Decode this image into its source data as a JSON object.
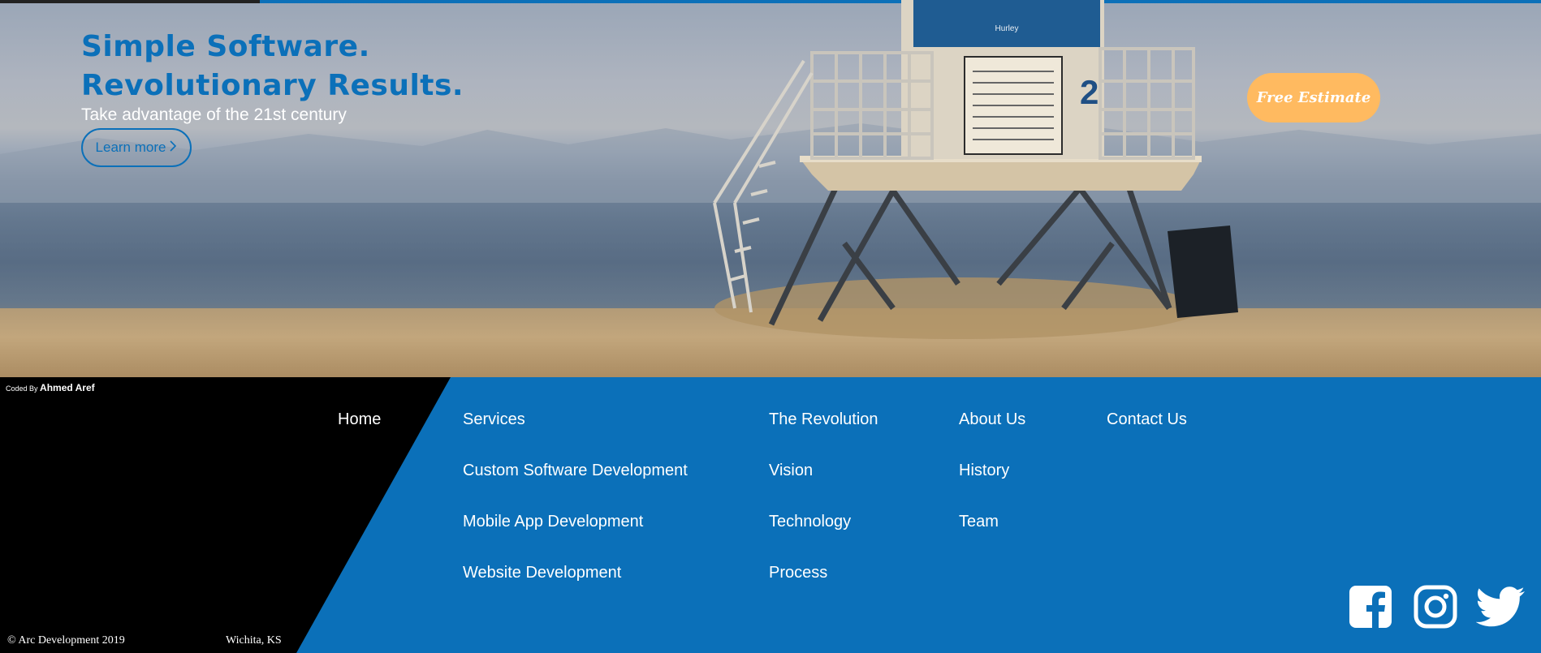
{
  "hero": {
    "title_line1": "Simple Software.",
    "title_line2": "Revolutionary Results.",
    "subtitle": "Take advantage of the 21st century",
    "learn_more": "Learn more",
    "learn_more_icon": "chevron-right-icon",
    "estimate": "Free Estimate",
    "photo_signage": {
      "brand": "Hurley",
      "tower_number": "2"
    }
  },
  "footer": {
    "credit_prefix": "Coded By",
    "credit_name": "Ahmed Aref",
    "home": "Home",
    "columns": [
      [
        "Services",
        "Custom Software Development",
        "Mobile App Development",
        "Website Development"
      ],
      [
        "The Revolution",
        "Vision",
        "Technology",
        "Process"
      ],
      [
        "About Us",
        "History",
        "Team"
      ],
      [
        "Contact Us"
      ]
    ],
    "copyright": "© Arc Development 2019",
    "location": "Wichita, KS",
    "social": [
      "facebook-icon",
      "instagram-icon",
      "twitter-icon"
    ]
  },
  "colors": {
    "brand_blue": "#0b70b9",
    "estimate_orange": "#ffba60",
    "black": "#000000"
  }
}
